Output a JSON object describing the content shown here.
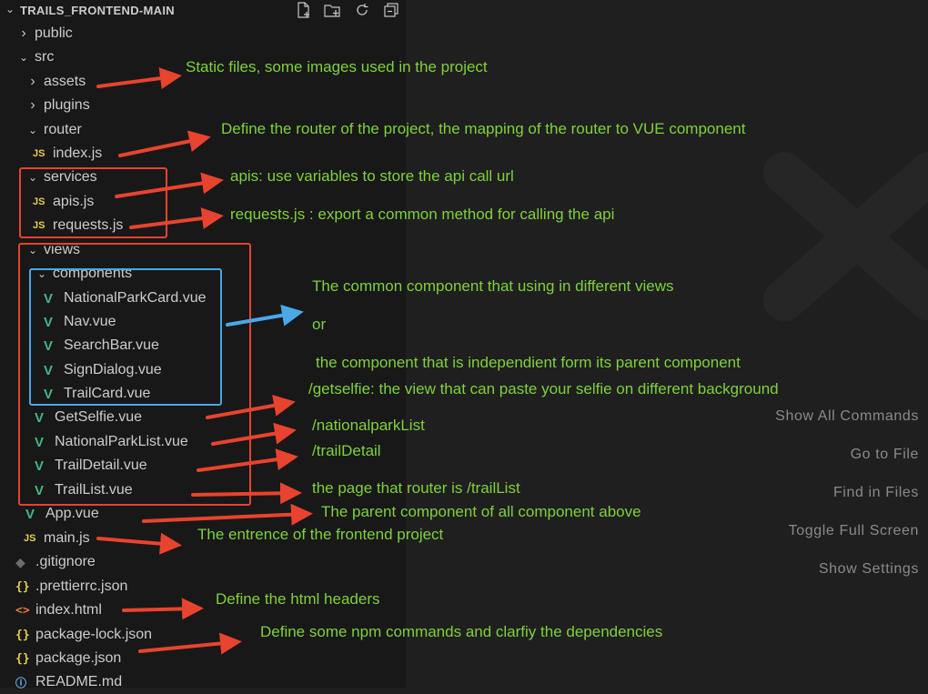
{
  "explorer": {
    "title": "TRAILS_FRONTEND-MAIN",
    "actions": [
      "new-file-icon",
      "new-folder-icon",
      "refresh-icon",
      "collapse-all-icon"
    ],
    "items": [
      {
        "label": "public",
        "kind": "folder",
        "state": "collapsed",
        "icon": "chevron-right-icon"
      },
      {
        "label": "src",
        "kind": "folder",
        "state": "expanded",
        "icon": "chevron-down-icon"
      },
      {
        "label": "assets",
        "kind": "folder",
        "state": "collapsed",
        "icon": "chevron-right-icon"
      },
      {
        "label": "plugins",
        "kind": "folder",
        "state": "collapsed",
        "icon": "chevron-right-icon"
      },
      {
        "label": "router",
        "kind": "folder",
        "state": "expanded",
        "icon": "chevron-down-icon"
      },
      {
        "label": "index.js",
        "kind": "file",
        "icon": "js-file-icon",
        "glyph": "JS"
      },
      {
        "label": "services",
        "kind": "folder",
        "state": "expanded",
        "icon": "chevron-down-icon"
      },
      {
        "label": "apis.js",
        "kind": "file",
        "icon": "js-file-icon",
        "glyph": "JS"
      },
      {
        "label": "requests.js",
        "kind": "file",
        "icon": "js-file-icon",
        "glyph": "JS"
      },
      {
        "label": "views",
        "kind": "folder",
        "state": "expanded",
        "icon": "chevron-down-icon"
      },
      {
        "label": "components",
        "kind": "folder",
        "state": "expanded",
        "icon": "chevron-down-icon"
      },
      {
        "label": "NationalParkCard.vue",
        "kind": "file",
        "icon": "vue-file-icon",
        "glyph": "V"
      },
      {
        "label": "Nav.vue",
        "kind": "file",
        "icon": "vue-file-icon",
        "glyph": "V"
      },
      {
        "label": "SearchBar.vue",
        "kind": "file",
        "icon": "vue-file-icon",
        "glyph": "V"
      },
      {
        "label": "SignDialog.vue",
        "kind": "file",
        "icon": "vue-file-icon",
        "glyph": "V"
      },
      {
        "label": "TrailCard.vue",
        "kind": "file",
        "icon": "vue-file-icon",
        "glyph": "V"
      },
      {
        "label": "GetSelfie.vue",
        "kind": "file",
        "icon": "vue-file-icon",
        "glyph": "V"
      },
      {
        "label": "NationalParkList.vue",
        "kind": "file",
        "icon": "vue-file-icon",
        "glyph": "V"
      },
      {
        "label": "TrailDetail.vue",
        "kind": "file",
        "icon": "vue-file-icon",
        "glyph": "V"
      },
      {
        "label": "TrailList.vue",
        "kind": "file",
        "icon": "vue-file-icon",
        "glyph": "V"
      },
      {
        "label": "App.vue",
        "kind": "file",
        "icon": "vue-file-icon",
        "glyph": "V"
      },
      {
        "label": "main.js",
        "kind": "file",
        "icon": "js-file-icon",
        "glyph": "JS"
      },
      {
        "label": ".gitignore",
        "kind": "file",
        "icon": "git-file-icon",
        "glyph": "◆"
      },
      {
        "label": ".prettierrc.json",
        "kind": "file",
        "icon": "json-file-icon",
        "glyph": "{}"
      },
      {
        "label": "index.html",
        "kind": "file",
        "icon": "html-file-icon",
        "glyph": "<>"
      },
      {
        "label": "package-lock.json",
        "kind": "file",
        "icon": "json-file-icon",
        "glyph": "{}"
      },
      {
        "label": "package.json",
        "kind": "file",
        "icon": "json-file-icon",
        "glyph": "{}"
      },
      {
        "label": "README.md",
        "kind": "file",
        "icon": "info-file-icon",
        "glyph": "ⓘ"
      }
    ]
  },
  "annotations": [
    "Static files, some images used in the project",
    "Define the router of the project, the mapping of the router to VUE component",
    "apis: use variables to store the api call url",
    "requests.js :  export a common method for calling the api",
    "The common component that using in different views",
    "or",
    "the component that is independient form its parent component",
    "/getselfie: the view that can paste your selfie on different background",
    "/nationalparkList",
    "/trailDetail",
    "the page that router is /trailList",
    "The parent component of all component above",
    "The entrence of the frontend project",
    "Define the html headers",
    "Define some npm commands and clarfiy the dependencies"
  ],
  "editor": {
    "shortcuts": [
      "Show All Commands",
      "Go to File",
      "Find in Files",
      "Toggle Full Screen",
      "Show Settings"
    ],
    "watermark_icon": "vscode-logo-watermark"
  },
  "colors": {
    "annotation_text": "#7fd13b",
    "arrow_red": "#e8432f",
    "arrow_blue": "#4aa8e8"
  }
}
